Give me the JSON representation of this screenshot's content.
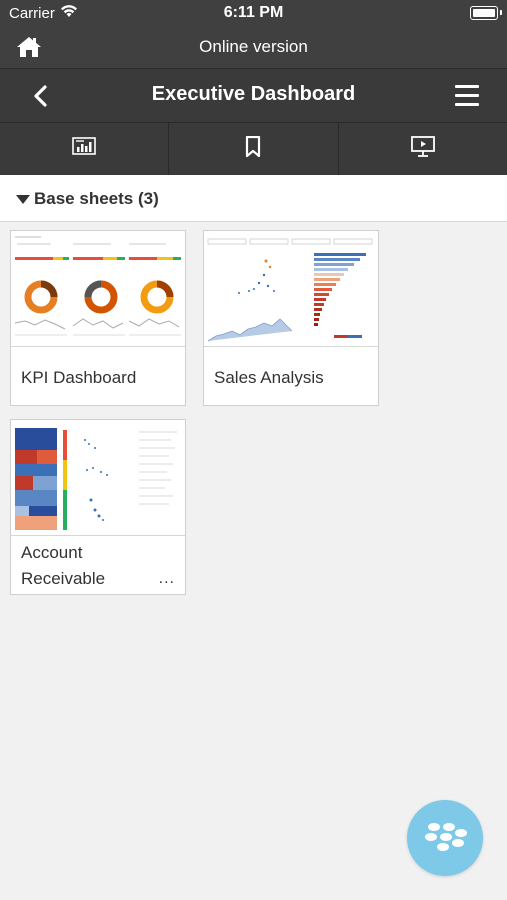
{
  "status_bar": {
    "carrier": "Carrier",
    "time": "6:11 PM"
  },
  "online_bar": {
    "label": "Online version",
    "home_icon": "home-icon"
  },
  "title_bar": {
    "title": "Executive Dashboard",
    "back_icon": "chevron-left-icon",
    "menu_icon": "hamburger-menu-icon"
  },
  "toolbar": {
    "tools": [
      {
        "icon": "chart-sheet-icon"
      },
      {
        "icon": "bookmark-icon"
      },
      {
        "icon": "presentation-icon"
      }
    ]
  },
  "section": {
    "label": "Base sheets (3)"
  },
  "sheets": [
    {
      "name": "KPI Dashboard"
    },
    {
      "name": "Sales Analysis"
    },
    {
      "name_line1": "Account",
      "name_line2": "Receivable",
      "more": "..."
    }
  ],
  "colors": {
    "header_bg": "#404040",
    "title_bg": "#3a3a3a",
    "page_bg": "#f1f1f1",
    "bb_button": "#7ec8e8"
  },
  "fab": {
    "icon": "blackberry-logo-icon"
  }
}
